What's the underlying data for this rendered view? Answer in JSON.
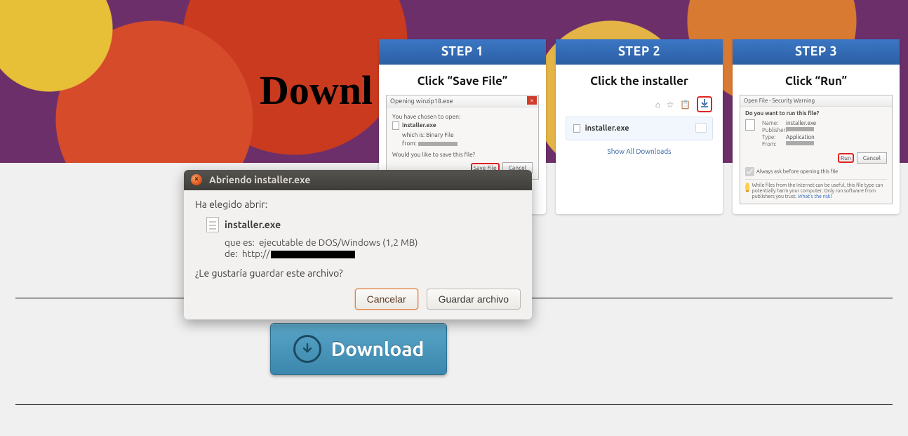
{
  "hero": {
    "title": "Downl"
  },
  "steps": [
    {
      "header": "STEP 1",
      "sub": "Click “Save File”",
      "dialog_title": "Opening winzip18.exe",
      "chosen": "You have chosen to open:",
      "file": "installer.exe",
      "which_label": "which is:",
      "which_value": "Binary File",
      "from_label": "from:",
      "question": "Would you like to save this file?",
      "save": "Save File",
      "cancel": "Cancel"
    },
    {
      "header": "STEP 2",
      "sub": "Click the installer",
      "file": "installer.exe",
      "show_all": "Show All Downloads"
    },
    {
      "header": "STEP 3",
      "sub": "Click “Run”",
      "title": "Open File - Security Warning",
      "question": "Do you want to run this file?",
      "name_label": "Name:",
      "name_value": "installer.exe",
      "publisher_label": "Publisher:",
      "type_label": "Type:",
      "type_value": "Application",
      "from_label": "From:",
      "run": "Run",
      "cancel": "Cancel",
      "always_ask": "Always ask before opening this file",
      "warn": "While files from the Internet can be useful, this file type can potentially harm your computer. Only run software from publishers you trust.",
      "warn_link": "What's the risk?"
    }
  ],
  "download_button": "Download",
  "ubuntu": {
    "title": "Abriendo installer.exe",
    "lead": "Ha elegido abrir:",
    "file": "installer.exe",
    "which_label": "que es:",
    "which_value": "ejecutable de DOS/Windows (1,2 MB)",
    "from_label": "de:",
    "from_value_prefix": "http://",
    "question": "¿Le gustaría guardar este archivo?",
    "cancel": "Cancelar",
    "save": "Guardar archivo"
  }
}
